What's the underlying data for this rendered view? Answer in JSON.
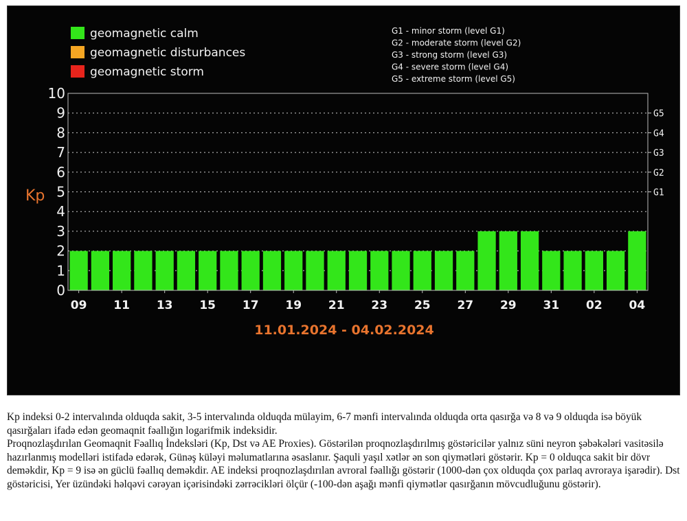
{
  "legend": [
    {
      "label": "geomagnetic calm",
      "color": "#33e61a"
    },
    {
      "label": "geomagnetic disturbances",
      "color": "#f5a623"
    },
    {
      "label": "geomagnetic storm",
      "color": "#e8241c"
    }
  ],
  "storm_levels": [
    "G1 - minor storm (level G1)",
    "G2 - moderate storm (level G2)",
    "G3 - strong storm (level G3)",
    "G4 - severe storm (level G4)",
    "G5 - extreme storm (level G5)"
  ],
  "chart_data": {
    "type": "bar",
    "ylabel": "Kp",
    "ylim": [
      0,
      10
    ],
    "yticks": [
      "0",
      "1",
      "2",
      "3",
      "4",
      "5",
      "6",
      "7",
      "8",
      "9",
      "10"
    ],
    "right_axis": [
      {
        "label": "G1",
        "at": 5
      },
      {
        "label": "G2",
        "at": 6
      },
      {
        "label": "G3",
        "at": 7
      },
      {
        "label": "G4",
        "at": 8
      },
      {
        "label": "G5",
        "at": 9
      }
    ],
    "date_range": "11.01.2024 - 04.02.2024",
    "x_tick_labels": [
      "09",
      "11",
      "13",
      "15",
      "17",
      "19",
      "21",
      "23",
      "25",
      "27",
      "29",
      "31",
      "02",
      "04"
    ],
    "values": [
      2,
      2,
      2,
      2,
      2,
      2,
      2,
      2,
      2,
      2,
      2,
      2,
      2,
      2,
      2,
      2,
      2,
      2,
      2,
      3,
      3,
      3,
      2,
      2,
      2,
      2,
      3
    ],
    "bar_color": "#33e61a",
    "grid": true
  },
  "caption": [
    "Kp indeksi 0-2 intervalında olduqda sakit, 3-5 intervalında olduqda mülayim, 6-7 mənfi intervalında olduqda orta qasırğa və 8 və 9 olduqda isə böyük qasırğaları ifadə edən geomaqnit fəallığın logarifmik indeksidir.",
    "Proqnozlaşdırılan Geomaqnit Fəallıq İndeksləri (Kp, Dst və AE Proxies). Göstərilən proqnozlaşdırılmış göstəricilər yalnız süni neyron şəbəkələri vasitəsilə hazırlanmış modelləri istifadə edərək, Günəş küləyi məlumatlarına əsaslanır. Şaquli yaşıl xətlər ən son qiymətləri göstərir. Kp = 0 olduqca sakit bir dövr deməkdir, Kp = 9 isə ən güclü fəallıq deməkdir. AE indeksi proqnozlaşdırılan avroral fəallığı göstərir (1000-dən çox olduqda çox parlaq avroraya işarədir). Dst göstəricisi, Yer üzündəki həlqəvi cərəyan içərisindəki zərrəcikləri ölçür (-100-dən aşağı mənfi qiymətlər qasırğanın mövcudluğunu göstərir)."
  ]
}
